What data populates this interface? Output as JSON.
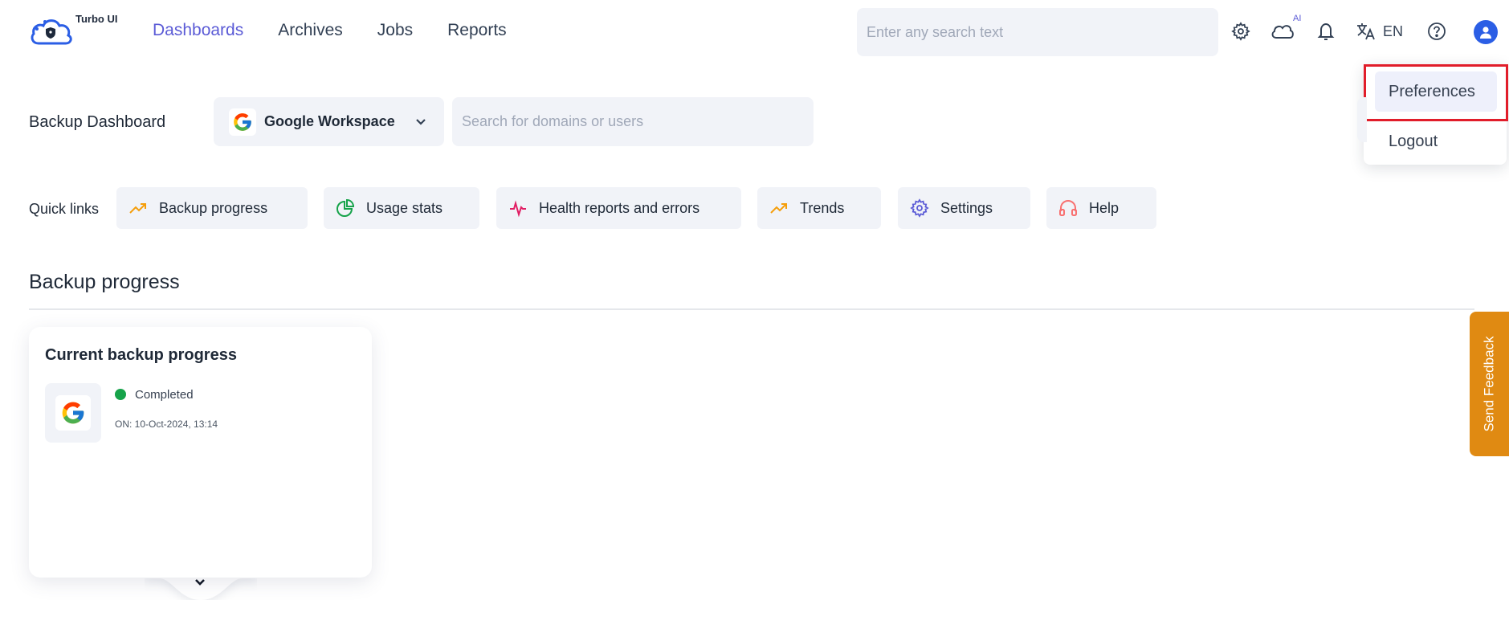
{
  "brand": {
    "name": "Turbo UI"
  },
  "nav": {
    "items": [
      {
        "label": "Dashboards",
        "active": true
      },
      {
        "label": "Archives",
        "active": false
      },
      {
        "label": "Jobs",
        "active": false
      },
      {
        "label": "Reports",
        "active": false
      }
    ]
  },
  "header": {
    "search_placeholder": "Enter any search text",
    "ai_tag": "AI",
    "language": "EN",
    "icons": [
      "gear-icon",
      "cloud-ai-icon",
      "bell-icon",
      "translate-icon",
      "help-icon",
      "user-avatar-icon"
    ]
  },
  "user_menu": {
    "items": [
      {
        "label": "Preferences",
        "highlighted": true
      },
      {
        "label": "Logout",
        "highlighted": false
      }
    ]
  },
  "dashboard": {
    "title": "Backup Dashboard",
    "workspace": "Google Workspace",
    "domain_search_placeholder": "Search for domains or users"
  },
  "quick_links": {
    "label": "Quick links",
    "items": [
      {
        "label": "Backup progress",
        "icon": "trending-up-icon",
        "color": "#f59e0b"
      },
      {
        "label": "Usage stats",
        "icon": "pie-chart-icon",
        "color": "#16a34a"
      },
      {
        "label": "Health reports and errors",
        "icon": "pulse-icon",
        "color": "#e11d63"
      },
      {
        "label": "Trends",
        "icon": "trending-up-icon",
        "color": "#f59e0b"
      },
      {
        "label": "Settings",
        "icon": "gear-icon",
        "color": "#5b5bd6"
      },
      {
        "label": "Help",
        "icon": "headset-icon",
        "color": "#f87171"
      }
    ]
  },
  "section": {
    "title": "Backup progress",
    "card": {
      "title": "Current backup progress",
      "status": "Completed",
      "status_color": "#16a34a",
      "date": "ON: 10-Oct-2024, 13:14"
    }
  },
  "feedback": {
    "label": "Send Feedback"
  },
  "colors": {
    "accent": "#5b5bd6",
    "surface": "#f1f3f8",
    "feedback": "#e08a12"
  }
}
